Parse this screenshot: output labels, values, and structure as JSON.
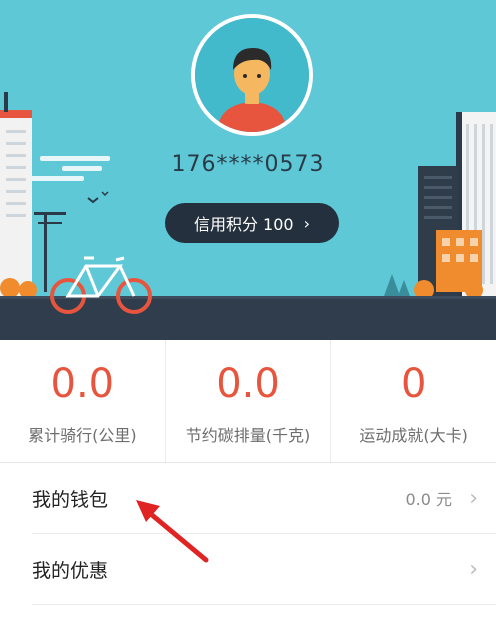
{
  "profile": {
    "phone": "176****0573",
    "credit_label": "信用积分 100",
    "credit_chevron": "›"
  },
  "stats": [
    {
      "value": "0.0",
      "label": "累计骑行(公里)"
    },
    {
      "value": "0.0",
      "label": "节约碳排量(千克)"
    },
    {
      "value": "0",
      "label": "运动成就(大卡)"
    }
  ],
  "menu": {
    "wallet": {
      "label": "我的钱包",
      "value": "0.0 元",
      "chevron": "›"
    },
    "coupons": {
      "label": "我的优惠",
      "chevron": "›"
    }
  },
  "colors": {
    "header_bg": "#5ec8d6",
    "accent": "#e8553e",
    "pill_bg": "#24303d",
    "annotation_arrow": "#e02424"
  },
  "icons": {
    "avatar": "user-avatar-icon",
    "bicycle": "bicycle-illustration",
    "annotation": "red-pointer-arrow"
  }
}
